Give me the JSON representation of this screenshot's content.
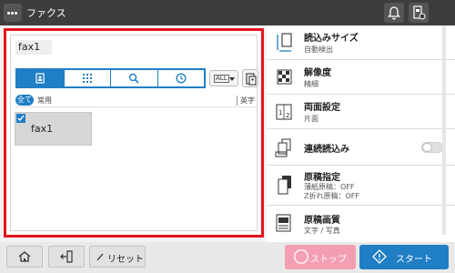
{
  "header": {
    "title": "ファクス"
  },
  "destination": {
    "value": "fax1"
  },
  "tabs": [
    {
      "icon": "address-book-icon",
      "active": true
    },
    {
      "icon": "numeric-keypad-icon",
      "active": false
    },
    {
      "icon": "search-icon",
      "active": false
    },
    {
      "icon": "history-clock-icon",
      "active": false
    }
  ],
  "sort": {
    "value": "ALL"
  },
  "filter": {
    "all": "全て",
    "common": "常用",
    "index": "英字"
  },
  "entries": [
    {
      "name": "fax1",
      "checked": true
    }
  ],
  "settings": [
    {
      "title": "読込みサイズ",
      "sub": "自動検出",
      "icon": "scan-size-icon"
    },
    {
      "title": "解像度",
      "sub": "精細",
      "icon": "resolution-icon"
    },
    {
      "title": "両面設定",
      "sub": "片面",
      "icon": "duplex-icon"
    },
    {
      "title": "連続読込み",
      "icon": "continuous-scan-icon",
      "toggle": false
    },
    {
      "title": "原稿指定",
      "sub": "薄紙原稿：OFF",
      "sub2": "Z折れ原稿：OFF",
      "icon": "original-type-icon"
    },
    {
      "title": "原稿画質",
      "sub": "文字 / 写真",
      "icon": "image-quality-icon"
    }
  ],
  "bottom": {
    "reset": "リセット",
    "stop": "ストップ",
    "start": "スタート"
  },
  "colors": {
    "accent": "#1f7ec4",
    "highlight_frame": "#e6141c",
    "stop": "#f39fb1",
    "topbar": "#3d3d3d"
  }
}
